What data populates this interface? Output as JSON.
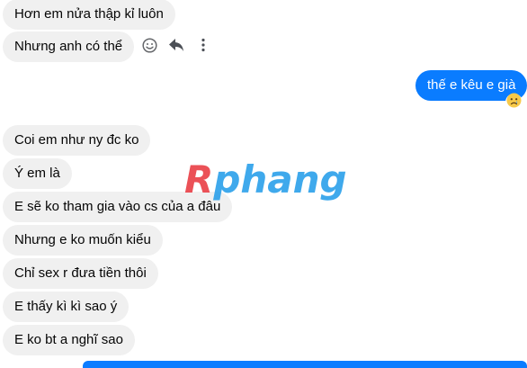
{
  "messages": [
    {
      "id": "m1",
      "side": "received",
      "text": "Hơn em nửa thập kỉ luôn"
    },
    {
      "id": "m2",
      "side": "received",
      "text": "Nhưng anh có thể"
    },
    {
      "id": "m3",
      "side": "sent",
      "text": "thế e kêu e già"
    },
    {
      "id": "m4",
      "side": "received",
      "text": "Coi em như ny đc ko"
    },
    {
      "id": "m5",
      "side": "received",
      "text": "Ý em là"
    },
    {
      "id": "m6",
      "side": "received",
      "text": "E sẽ ko tham gia vào cs của a đâu"
    },
    {
      "id": "m7",
      "side": "received",
      "text": "Nhưng e ko muốn kiểu"
    },
    {
      "id": "m8",
      "side": "received",
      "text": "Chỉ sex r đưa tiền thôi"
    },
    {
      "id": "m9",
      "side": "received",
      "text": "E thấy kì kì sao ý"
    },
    {
      "id": "m10",
      "side": "received",
      "text": "E ko bt a nghĩ sao"
    }
  ],
  "message_actions": [
    "react-smiley-icon",
    "reply-arrow-icon",
    "more-options-icon"
  ],
  "reaction": {
    "emoji": "sad-face-icon",
    "on_message": "m3"
  },
  "watermark": {
    "text_first": "R",
    "text_rest": "phang"
  },
  "colors": {
    "sent_bubble": "#0a7cff",
    "received_bubble": "#f0f0f0",
    "watermark_red": "#e8333a",
    "watermark_blue": "#1e9be9"
  }
}
